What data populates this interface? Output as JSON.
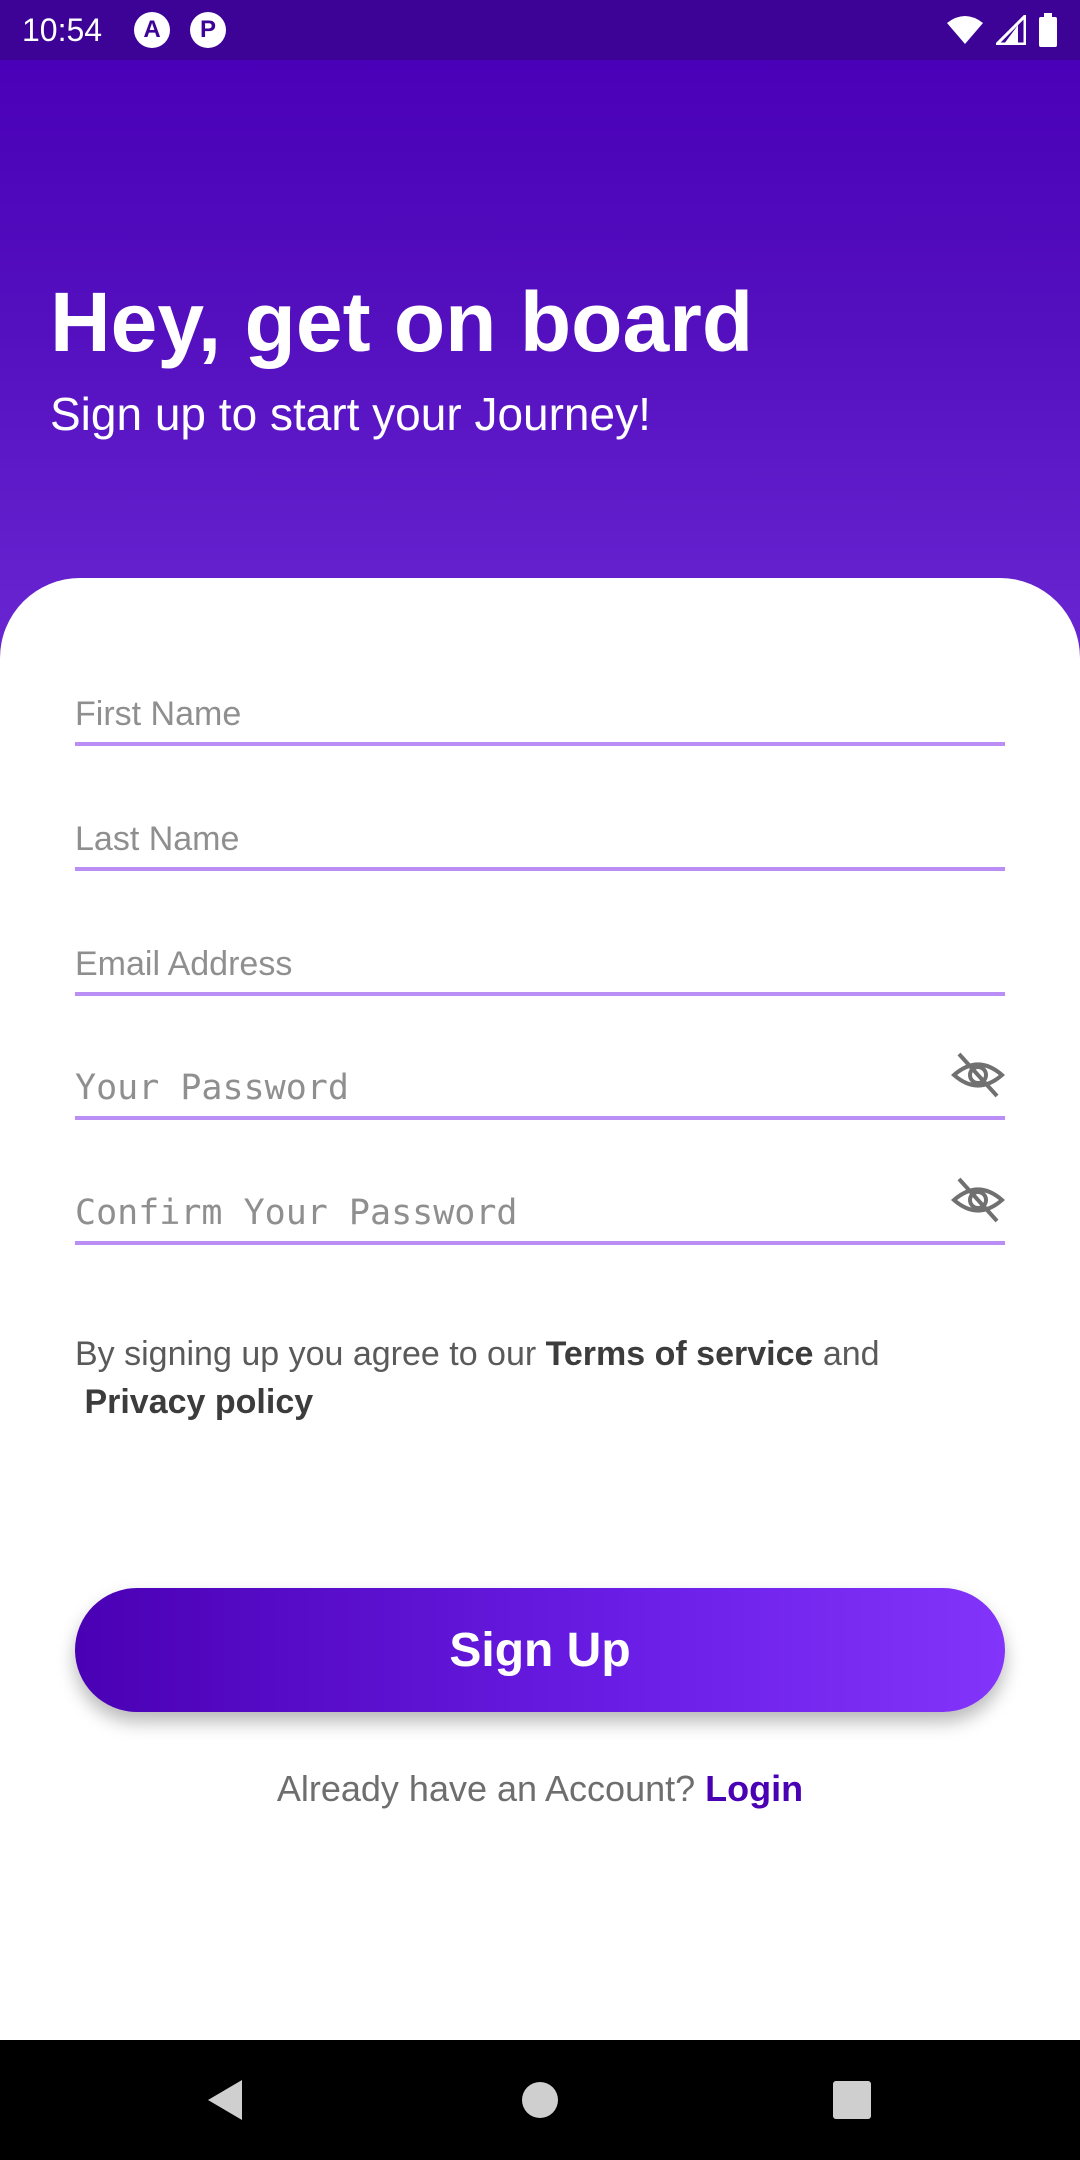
{
  "status_bar": {
    "time": "10:54",
    "app_icons": [
      "A",
      "P"
    ]
  },
  "header": {
    "title": "Hey, get on board",
    "subtitle": "Sign up to start your Journey!"
  },
  "form": {
    "first_name": {
      "placeholder": "First Name",
      "value": ""
    },
    "last_name": {
      "placeholder": "Last Name",
      "value": ""
    },
    "email": {
      "placeholder": "Email Address",
      "value": ""
    },
    "password": {
      "placeholder": "Your Password",
      "value": ""
    },
    "confirm_password": {
      "placeholder": "Confirm Your Password",
      "value": ""
    },
    "legal_prefix": "By signing up you agree to our",
    "terms_link": "Terms of service",
    "legal_and": "and",
    "privacy_link": "Privacy policy",
    "signup_label": "Sign Up"
  },
  "footer": {
    "prompt": "Already have an Account?",
    "login_link": "Login"
  },
  "colors": {
    "primary": "#4a00b3",
    "accent": "#8334fa",
    "field_underline": "#bb8ef5"
  }
}
